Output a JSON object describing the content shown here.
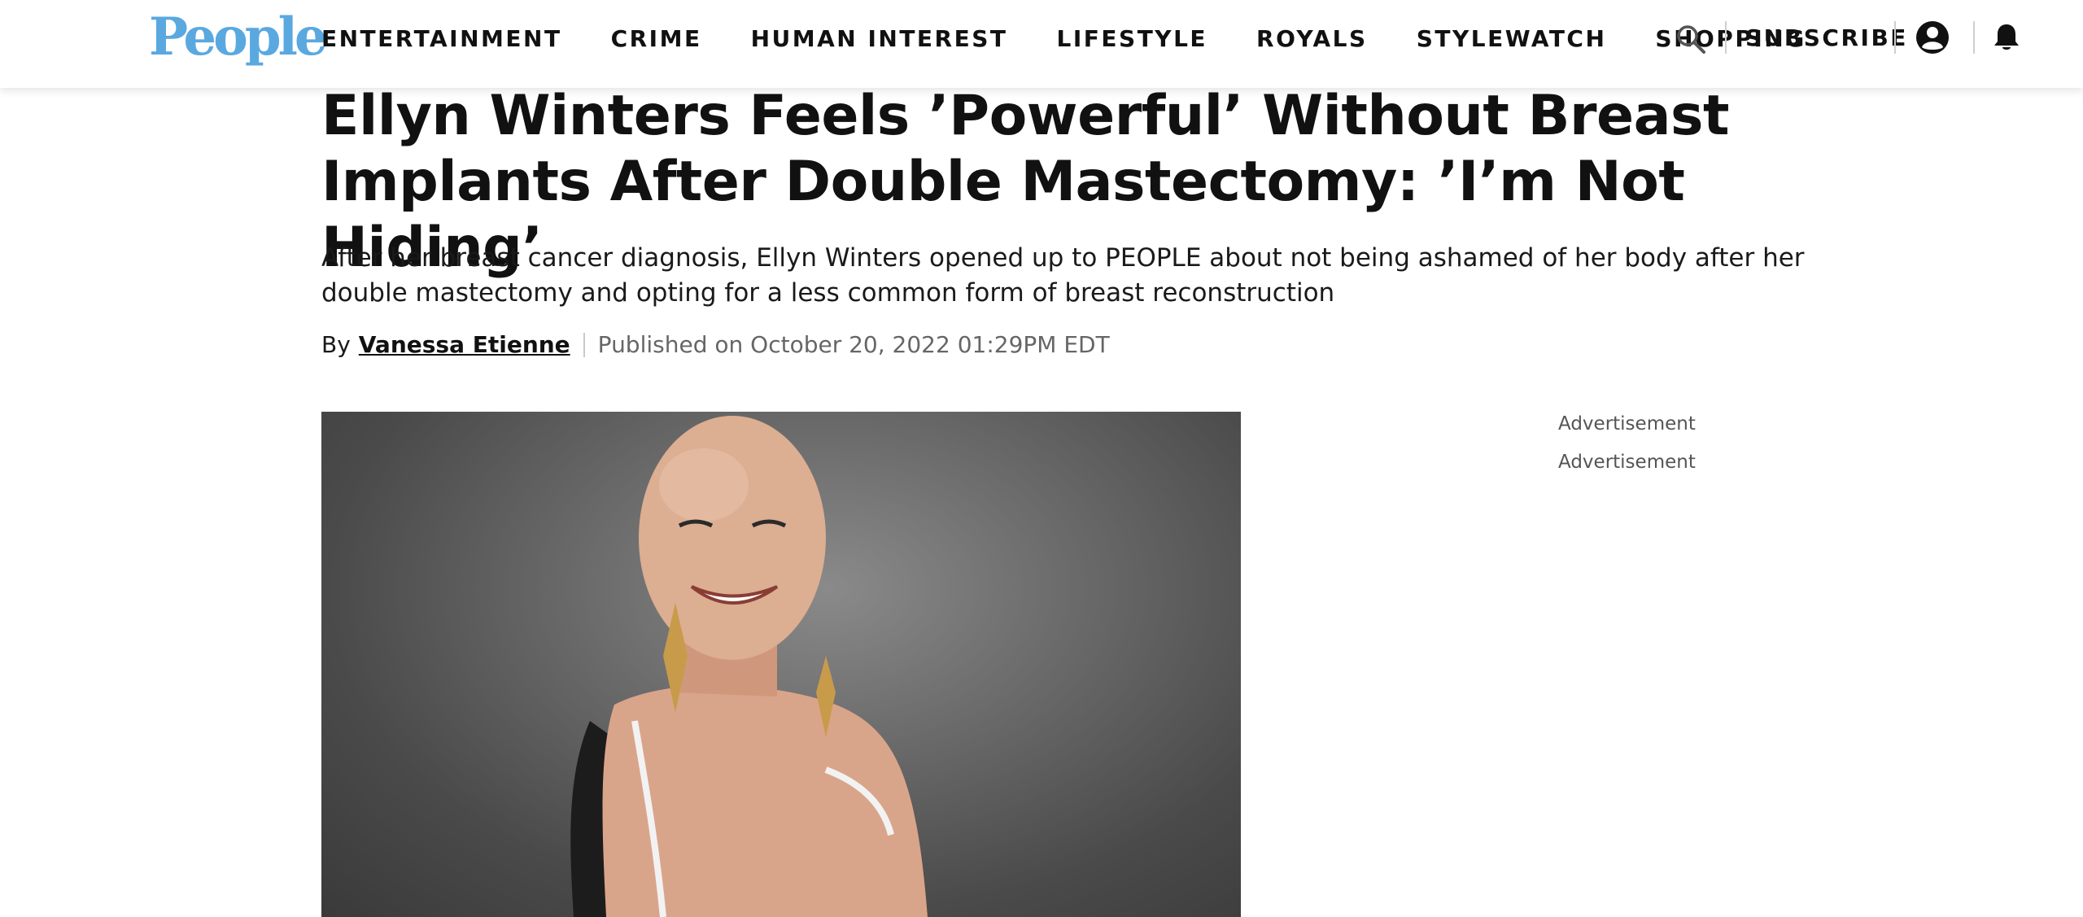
{
  "header": {
    "logo": "People",
    "nav": [
      "ENTERTAINMENT",
      "CRIME",
      "HUMAN INTEREST",
      "LIFESTYLE",
      "ROYALS",
      "STYLEWATCH",
      "SHOPPING"
    ],
    "subscribe": "SUBSCRIBE",
    "icons": [
      "search-icon",
      "account-icon",
      "bell-icon"
    ]
  },
  "article": {
    "headline": "Ellyn Winters Feels ’Powerful’ Without Breast Implants After Double Mastectomy: ’I’m Not Hiding’",
    "dek": "After her breast cancer diagnosis, Ellyn Winters opened up to PEOPLE about not being ashamed of her body after her double mastectomy and opting for a less common form of breast reconstruction",
    "by_label": "By",
    "author": "Vanessa Etienne",
    "published": "Published on October 20, 2022 01:29PM EDT"
  },
  "sidebar": {
    "ads": [
      "Advertisement",
      "Advertisement"
    ]
  },
  "colors": {
    "brand": "#5aa8e0",
    "text": "#111111",
    "muted": "#666666"
  }
}
